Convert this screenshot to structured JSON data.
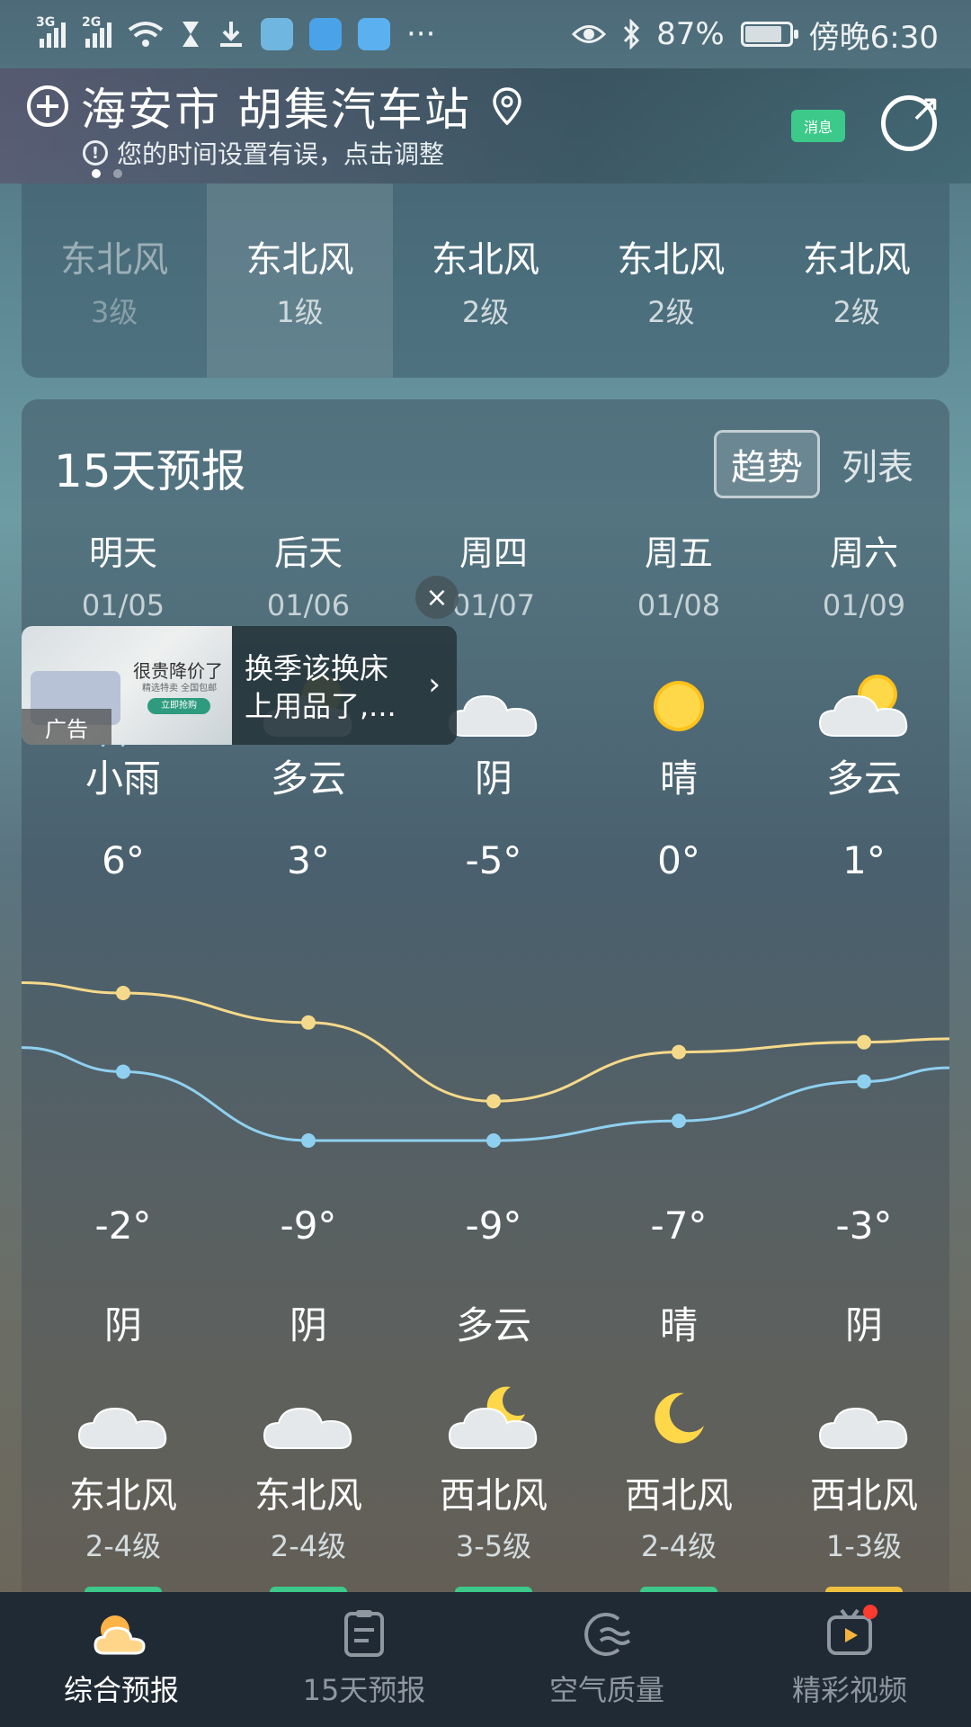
{
  "status_bar": {
    "net1": "3G",
    "net2": "2G",
    "more": "···",
    "battery": "87%",
    "time": "傍晚6:30"
  },
  "header": {
    "location": "海安市 胡集汽车站",
    "warning": "您的时间设置有误，点击调整",
    "message_badge": "消息",
    "page_dots": 2
  },
  "wind_strip": [
    {
      "dir": "东北风",
      "level": "3级"
    },
    {
      "dir": "东北风",
      "level": "1级"
    },
    {
      "dir": "东北风",
      "level": "2级"
    },
    {
      "dir": "东北风",
      "level": "2级"
    },
    {
      "dir": "东北风",
      "level": "2级"
    }
  ],
  "forecast": {
    "title": "15天预报",
    "tab_trend": "趋势",
    "tab_list": "列表",
    "days": [
      {
        "day": "明天",
        "date": "01/05",
        "day_weather": "小雨",
        "high": "6°",
        "low": "-2°",
        "night_weather": "阴",
        "wind_dir": "东北风",
        "wind_level": "2-4级",
        "day_icon": "rain-icon",
        "night_icon": "cloud-icon"
      },
      {
        "day": "后天",
        "date": "01/06",
        "day_weather": "多云",
        "high": "3°",
        "low": "-9°",
        "night_weather": "阴",
        "wind_dir": "东北风",
        "wind_level": "2-4级",
        "day_icon": "partly-cloudy-icon",
        "night_icon": "cloud-icon"
      },
      {
        "day": "周四",
        "date": "01/07",
        "day_weather": "阴",
        "high": "-5°",
        "low": "-9°",
        "night_weather": "多云",
        "wind_dir": "西北风",
        "wind_level": "3-5级",
        "day_icon": "cloud-icon",
        "night_icon": "moon-cloud-icon"
      },
      {
        "day": "周五",
        "date": "01/08",
        "day_weather": "晴",
        "high": "0°",
        "low": "-7°",
        "night_weather": "晴",
        "wind_dir": "西北风",
        "wind_level": "2-4级",
        "day_icon": "sun-icon",
        "night_icon": "moon-icon"
      },
      {
        "day": "周六",
        "date": "01/09",
        "day_weather": "多云",
        "high": "1°",
        "low": "-3°",
        "night_weather": "阴",
        "wind_dir": "西北风",
        "wind_level": "1-3级",
        "day_icon": "sun-cloud-icon",
        "night_icon": "cloud-icon"
      }
    ],
    "aqi_colors": [
      "#3cc98a",
      "#3cc98a",
      "#3cc98a",
      "#3cc98a",
      "#f0c040"
    ]
  },
  "chart_data": {
    "type": "line",
    "categories": [
      "01/05",
      "01/06",
      "01/07",
      "01/08",
      "01/09"
    ],
    "series": [
      {
        "values": [
          6,
          3,
          -5,
          0,
          1
        ],
        "color": "#f5d98a"
      },
      {
        "values": [
          -2,
          -9,
          -9,
          -7,
          -3
        ],
        "color": "#8fd0f0"
      }
    ]
  },
  "ad": {
    "line1": "换季该换床",
    "line2": "上用品了,...",
    "image_headline": "很贵降价了",
    "image_sub": "精选特卖 全国包邮",
    "image_button": "立即抢购",
    "label": "广告",
    "close": "×"
  },
  "bottom_nav": [
    {
      "label": "综合预报",
      "icon": "weather-icon",
      "active": true
    },
    {
      "label": "15天预报",
      "icon": "calendar-icon",
      "active": false
    },
    {
      "label": "空气质量",
      "icon": "air-icon",
      "active": false
    },
    {
      "label": "精彩视频",
      "icon": "video-icon",
      "active": false
    }
  ]
}
